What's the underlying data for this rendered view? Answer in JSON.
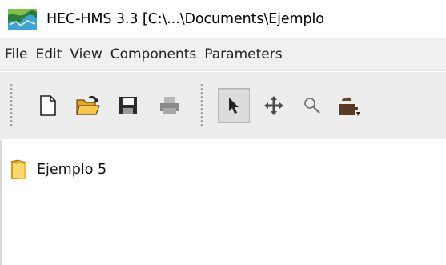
{
  "window": {
    "title": "HEC-HMS 3.3 [C:\\...\\Documents\\Ejemplo",
    "icon": "hec-hms-app-icon"
  },
  "menubar": {
    "items": [
      {
        "label": "File"
      },
      {
        "label": "Edit"
      },
      {
        "label": "View"
      },
      {
        "label": "Components"
      },
      {
        "label": "Parameters"
      }
    ]
  },
  "toolbar": {
    "buttons": [
      {
        "icon": "new-file-icon",
        "enabled": true
      },
      {
        "icon": "open-folder-icon",
        "enabled": true
      },
      {
        "icon": "save-icon",
        "enabled": true
      },
      {
        "icon": "print-icon",
        "enabled": false
      },
      {
        "icon": "arrow-tool-icon",
        "enabled": true,
        "pressed": true
      },
      {
        "icon": "move-tool-icon",
        "enabled": true
      },
      {
        "icon": "zoom-tool-icon",
        "enabled": true
      },
      {
        "icon": "subbasin-tool-icon",
        "enabled": true
      }
    ]
  },
  "tree": {
    "nodes": [
      {
        "label": "Ejemplo 5",
        "icon": "folder-icon"
      }
    ]
  },
  "colors": {
    "menubar_bg": "#f0f0f0",
    "toolbar_bg": "#ededed",
    "folder_yellow": "#f2c037"
  }
}
